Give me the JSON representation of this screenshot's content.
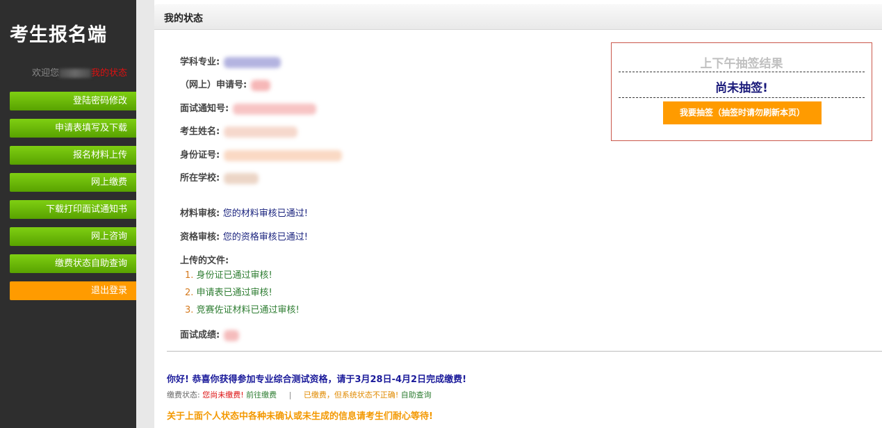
{
  "sidebar": {
    "title": "考生报名端",
    "welcome_label": "欢迎您",
    "welcome_link": "我的状态",
    "items": [
      {
        "label": "登陆密码修改"
      },
      {
        "label": "申请表填写及下载"
      },
      {
        "label": "报名材料上传"
      },
      {
        "label": "网上缴费"
      },
      {
        "label": "下载打印面试通知书"
      },
      {
        "label": "网上咨询"
      },
      {
        "label": "缴费状态自助查询"
      },
      {
        "label": "退出登录"
      }
    ]
  },
  "main": {
    "title": "我的状态",
    "fields": {
      "subject_label": "学科专业:",
      "app_no_label": "（网上）申请号:",
      "interview_no_label": "面试通知号:",
      "name_label": "考生姓名:",
      "id_label": "身份证号:",
      "school_label": "所在学校:",
      "material_label": "材料审核:",
      "material_value": "您的材料审核已通过!",
      "qual_label": "资格审核:",
      "qual_value": "您的资格审核已通过!"
    },
    "files": {
      "title": "上传的文件:",
      "items": [
        {
          "num": "1.",
          "text": "身份证已通过审核!"
        },
        {
          "num": "2.",
          "text": "申请表已通过审核!"
        },
        {
          "num": "3.",
          "text": "竞赛佐证材料已通过审核!"
        }
      ]
    },
    "score_label": "面试成绩:",
    "congrats": "你好! 恭喜你获得参加专业综合测试资格，请于3月28日-4月2日完成缴费!",
    "payment": {
      "label": "缴费状态:",
      "status": "您尚未缴费!",
      "go_pay": "前往缴费",
      "separator": "|",
      "paid_issue": "已缴费，但系统状态不正确!",
      "self_query": "自助查询"
    },
    "notice": "关于上面个人状态中各种未确认或未生成的信息请考生们耐心等待!"
  },
  "lottery": {
    "title": "上下午抽签结果",
    "result": "尚未抽签!",
    "button": "我要抽签（抽签时请勿刷新本页）"
  },
  "colors": {
    "sidebar_bg": "#2e2e2e",
    "nav_green": "#6bbf0a",
    "nav_orange": "#ff9b00",
    "accent_blue": "#1a1a9a",
    "notice_orange": "#f39800"
  }
}
